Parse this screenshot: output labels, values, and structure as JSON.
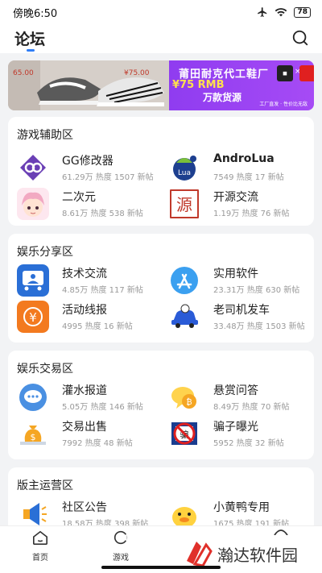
{
  "status_bar": {
    "time": "傍晚6:50",
    "battery": "78"
  },
  "header": {
    "title": "论坛"
  },
  "banner": {
    "title": "莆田耐克代工鞋厂",
    "price": "¥75 RMB",
    "subtitle": "万款货源",
    "footer": "工厂直发 · 性价比无敌",
    "shoe_price1": "65.00",
    "shoe_price2": "¥75.00"
  },
  "sections": [
    {
      "title": "游戏辅助区",
      "items": [
        {
          "name": "GG修改器",
          "stats": "61.29万 热度  1507 新帖",
          "icon": "gg-icon"
        },
        {
          "name": "AndroLua",
          "stats": "7549 热度  17 新帖",
          "icon": "androlua-icon"
        },
        {
          "name": "二次元",
          "stats": "8.61万 热度  538 新帖",
          "icon": "anime-icon"
        },
        {
          "name": "开源交流",
          "stats": "1.19万 热度  76 新帖",
          "icon": "opensource-icon"
        }
      ]
    },
    {
      "title": "娱乐分享区",
      "items": [
        {
          "name": "技术交流",
          "stats": "4.85万 热度  117 新帖",
          "icon": "tech-icon"
        },
        {
          "name": "实用软件",
          "stats": "23.31万 热度  630 新帖",
          "icon": "appstore-icon"
        },
        {
          "name": "活动线报",
          "stats": "4995 热度  16 新帖",
          "icon": "yen-icon"
        },
        {
          "name": "老司机发车",
          "stats": "33.48万 热度  1503 新帖",
          "icon": "car-icon"
        }
      ]
    },
    {
      "title": "娱乐交易区",
      "items": [
        {
          "name": "灌水报道",
          "stats": "5.05万 热度  146 新帖",
          "icon": "chat-icon"
        },
        {
          "name": "悬赏问答",
          "stats": "8.49万 热度  70 新帖",
          "icon": "bitcoin-icon"
        },
        {
          "name": "交易出售",
          "stats": "7992 热度  48 新帖",
          "icon": "money-bag-icon"
        },
        {
          "name": "骗子曝光",
          "stats": "5952 热度  32 新帖",
          "icon": "scam-icon"
        }
      ]
    },
    {
      "title": "版主运营区",
      "items": [
        {
          "name": "社区公告",
          "stats": "18.58万 热度  398 新帖",
          "icon": "megaphone-icon"
        },
        {
          "name": "小黄鸭专用",
          "stats": "1675 热度  191 新帖",
          "icon": "duck-icon"
        }
      ]
    }
  ],
  "bottom_nav": [
    {
      "label": "首页",
      "icon": "home-icon"
    },
    {
      "label": "游戏",
      "icon": "game-icon"
    }
  ],
  "watermark": {
    "text": "瀚达软件园"
  },
  "colors": {
    "accent": "#2f7df6",
    "banner_purple": "#9b3cf3"
  }
}
